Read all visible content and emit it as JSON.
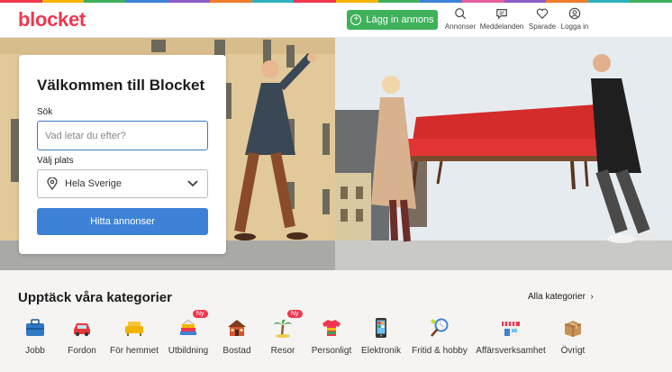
{
  "brand": {
    "logo_text": "blocket",
    "accent": "#f0374f",
    "post_color": "#3fb15a",
    "button_color": "#3d82d6"
  },
  "header": {
    "post_ad_label": "Lägg in annons",
    "nav": [
      {
        "label": "Annonser",
        "icon": "search-icon"
      },
      {
        "label": "Meddelanden",
        "icon": "chat-icon"
      },
      {
        "label": "Sparade",
        "icon": "heart-icon"
      },
      {
        "label": "Logga in",
        "icon": "user-icon"
      }
    ]
  },
  "search_card": {
    "title": "Välkommen till Blocket",
    "search_label": "Sök",
    "search_placeholder": "Vad letar du efter?",
    "location_label": "Välj plats",
    "location_value": "Hela Sverige",
    "submit_label": "Hitta annonser"
  },
  "categories": {
    "title": "Upptäck våra kategorier",
    "all_label": "Alla kategorier",
    "items": [
      {
        "label": "Jobb",
        "icon": "briefcase-icon"
      },
      {
        "label": "Fordon",
        "icon": "car-icon"
      },
      {
        "label": "För hemmet",
        "icon": "armchair-icon"
      },
      {
        "label": "Utbildning",
        "icon": "books-icon",
        "badge": "Ny"
      },
      {
        "label": "Bostad",
        "icon": "house-icon"
      },
      {
        "label": "Resor",
        "icon": "palm-tree-icon",
        "badge": "Ny"
      },
      {
        "label": "Personligt",
        "icon": "tshirt-icon"
      },
      {
        "label": "Elektronik",
        "icon": "phone-icon"
      },
      {
        "label": "Fritid & hobby",
        "icon": "racket-icon"
      },
      {
        "label": "Affärsverksamhet",
        "icon": "shop-icon"
      },
      {
        "label": "Övrigt",
        "icon": "box-icon"
      }
    ]
  }
}
